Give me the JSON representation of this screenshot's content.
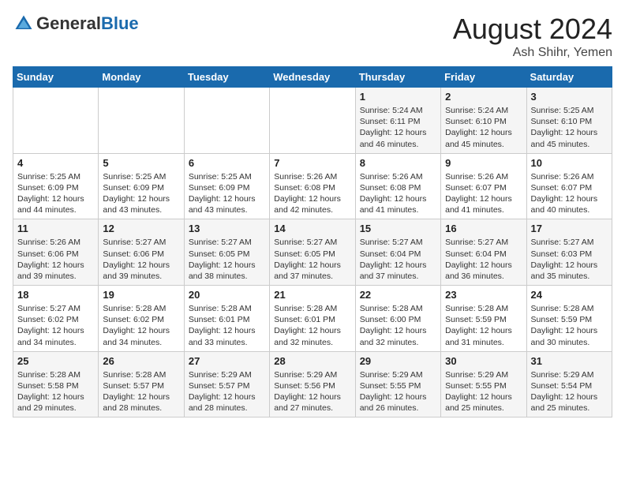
{
  "header": {
    "logo_general": "General",
    "logo_blue": "Blue",
    "month_title": "August 2024",
    "location": "Ash Shihr, Yemen"
  },
  "weekdays": [
    "Sunday",
    "Monday",
    "Tuesday",
    "Wednesday",
    "Thursday",
    "Friday",
    "Saturday"
  ],
  "weeks": [
    [
      {
        "day": "",
        "info": ""
      },
      {
        "day": "",
        "info": ""
      },
      {
        "day": "",
        "info": ""
      },
      {
        "day": "",
        "info": ""
      },
      {
        "day": "1",
        "info": "Sunrise: 5:24 AM\nSunset: 6:11 PM\nDaylight: 12 hours and 46 minutes."
      },
      {
        "day": "2",
        "info": "Sunrise: 5:24 AM\nSunset: 6:10 PM\nDaylight: 12 hours and 45 minutes."
      },
      {
        "day": "3",
        "info": "Sunrise: 5:25 AM\nSunset: 6:10 PM\nDaylight: 12 hours and 45 minutes."
      }
    ],
    [
      {
        "day": "4",
        "info": "Sunrise: 5:25 AM\nSunset: 6:09 PM\nDaylight: 12 hours and 44 minutes."
      },
      {
        "day": "5",
        "info": "Sunrise: 5:25 AM\nSunset: 6:09 PM\nDaylight: 12 hours and 43 minutes."
      },
      {
        "day": "6",
        "info": "Sunrise: 5:25 AM\nSunset: 6:09 PM\nDaylight: 12 hours and 43 minutes."
      },
      {
        "day": "7",
        "info": "Sunrise: 5:26 AM\nSunset: 6:08 PM\nDaylight: 12 hours and 42 minutes."
      },
      {
        "day": "8",
        "info": "Sunrise: 5:26 AM\nSunset: 6:08 PM\nDaylight: 12 hours and 41 minutes."
      },
      {
        "day": "9",
        "info": "Sunrise: 5:26 AM\nSunset: 6:07 PM\nDaylight: 12 hours and 41 minutes."
      },
      {
        "day": "10",
        "info": "Sunrise: 5:26 AM\nSunset: 6:07 PM\nDaylight: 12 hours and 40 minutes."
      }
    ],
    [
      {
        "day": "11",
        "info": "Sunrise: 5:26 AM\nSunset: 6:06 PM\nDaylight: 12 hours and 39 minutes."
      },
      {
        "day": "12",
        "info": "Sunrise: 5:27 AM\nSunset: 6:06 PM\nDaylight: 12 hours and 39 minutes."
      },
      {
        "day": "13",
        "info": "Sunrise: 5:27 AM\nSunset: 6:05 PM\nDaylight: 12 hours and 38 minutes."
      },
      {
        "day": "14",
        "info": "Sunrise: 5:27 AM\nSunset: 6:05 PM\nDaylight: 12 hours and 37 minutes."
      },
      {
        "day": "15",
        "info": "Sunrise: 5:27 AM\nSunset: 6:04 PM\nDaylight: 12 hours and 37 minutes."
      },
      {
        "day": "16",
        "info": "Sunrise: 5:27 AM\nSunset: 6:04 PM\nDaylight: 12 hours and 36 minutes."
      },
      {
        "day": "17",
        "info": "Sunrise: 5:27 AM\nSunset: 6:03 PM\nDaylight: 12 hours and 35 minutes."
      }
    ],
    [
      {
        "day": "18",
        "info": "Sunrise: 5:27 AM\nSunset: 6:02 PM\nDaylight: 12 hours and 34 minutes."
      },
      {
        "day": "19",
        "info": "Sunrise: 5:28 AM\nSunset: 6:02 PM\nDaylight: 12 hours and 34 minutes."
      },
      {
        "day": "20",
        "info": "Sunrise: 5:28 AM\nSunset: 6:01 PM\nDaylight: 12 hours and 33 minutes."
      },
      {
        "day": "21",
        "info": "Sunrise: 5:28 AM\nSunset: 6:01 PM\nDaylight: 12 hours and 32 minutes."
      },
      {
        "day": "22",
        "info": "Sunrise: 5:28 AM\nSunset: 6:00 PM\nDaylight: 12 hours and 32 minutes."
      },
      {
        "day": "23",
        "info": "Sunrise: 5:28 AM\nSunset: 5:59 PM\nDaylight: 12 hours and 31 minutes."
      },
      {
        "day": "24",
        "info": "Sunrise: 5:28 AM\nSunset: 5:59 PM\nDaylight: 12 hours and 30 minutes."
      }
    ],
    [
      {
        "day": "25",
        "info": "Sunrise: 5:28 AM\nSunset: 5:58 PM\nDaylight: 12 hours and 29 minutes."
      },
      {
        "day": "26",
        "info": "Sunrise: 5:28 AM\nSunset: 5:57 PM\nDaylight: 12 hours and 28 minutes."
      },
      {
        "day": "27",
        "info": "Sunrise: 5:29 AM\nSunset: 5:57 PM\nDaylight: 12 hours and 28 minutes."
      },
      {
        "day": "28",
        "info": "Sunrise: 5:29 AM\nSunset: 5:56 PM\nDaylight: 12 hours and 27 minutes."
      },
      {
        "day": "29",
        "info": "Sunrise: 5:29 AM\nSunset: 5:55 PM\nDaylight: 12 hours and 26 minutes."
      },
      {
        "day": "30",
        "info": "Sunrise: 5:29 AM\nSunset: 5:55 PM\nDaylight: 12 hours and 25 minutes."
      },
      {
        "day": "31",
        "info": "Sunrise: 5:29 AM\nSunset: 5:54 PM\nDaylight: 12 hours and 25 minutes."
      }
    ]
  ]
}
